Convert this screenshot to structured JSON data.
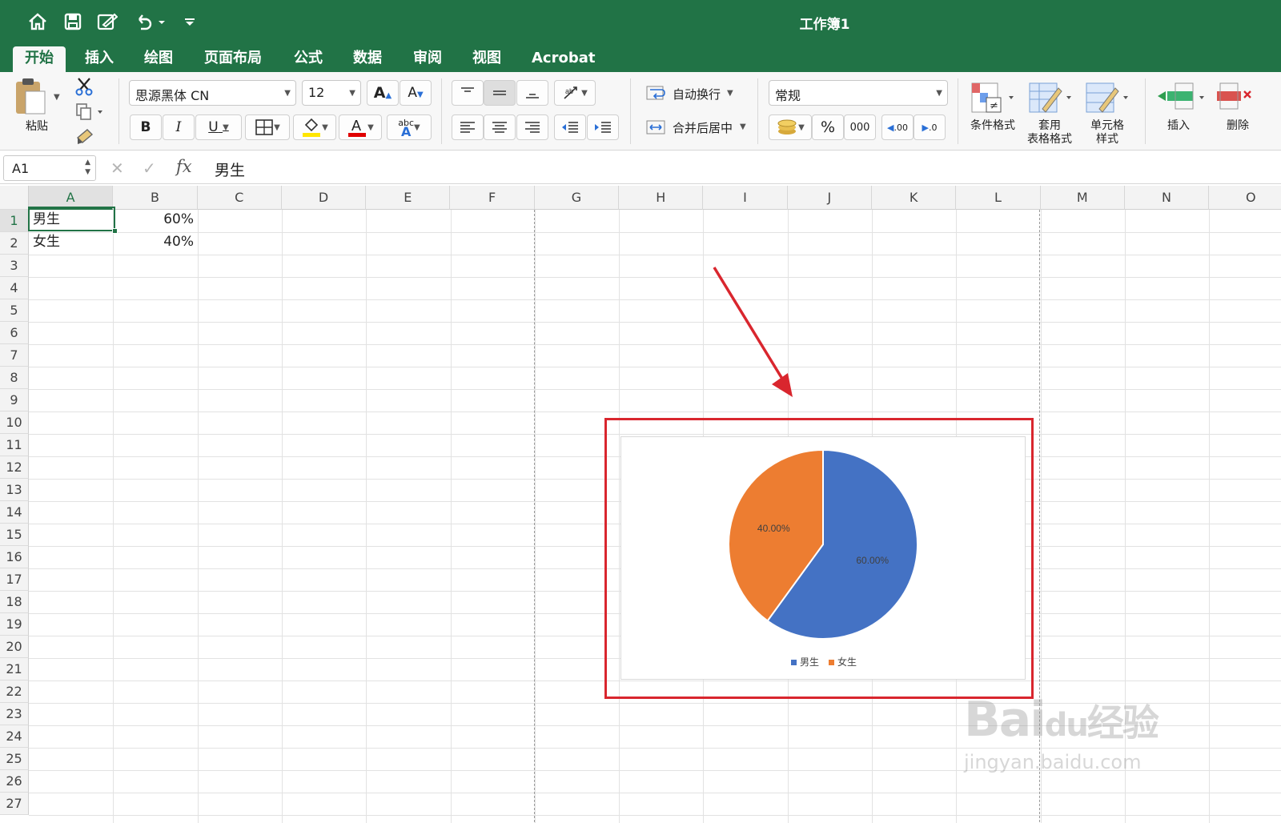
{
  "window": {
    "title": "工作簿1"
  },
  "quick_access": {
    "home_icon": "home-icon",
    "save_icon": "save-icon",
    "edit_icon": "edit-icon",
    "undo_icon": "undo-icon",
    "more_icon": "customize-icon"
  },
  "tabs": [
    {
      "label": "开始",
      "active": true
    },
    {
      "label": "插入"
    },
    {
      "label": "绘图"
    },
    {
      "label": "页面布局"
    },
    {
      "label": "公式"
    },
    {
      "label": "数据"
    },
    {
      "label": "审阅"
    },
    {
      "label": "视图"
    },
    {
      "label": "Acrobat"
    }
  ],
  "ribbon": {
    "paste_label": "粘贴",
    "font_name": "思源黑体 CN",
    "font_size": "12",
    "bold": "B",
    "italic": "I",
    "underline": "U",
    "wrap_text": "自动换行",
    "merge_center": "合并后居中",
    "number_format": "常规",
    "percent": "%",
    "thousands": "000",
    "cond_format": "条件格式",
    "table_format_1": "套用",
    "table_format_2": "表格格式",
    "cell_style_1": "单元格",
    "cell_style_2": "样式",
    "insert": "插入",
    "delete": "删除",
    "inc_decimal": ".00",
    "dec_decimal": ".0",
    "abc": "abc",
    "text_a": "A",
    "colors": {
      "highlight": "#ffe600",
      "font_color": "#e00000"
    }
  },
  "formula_bar": {
    "name_box": "A1",
    "fx": "fx",
    "content": "男生"
  },
  "columns": [
    "A",
    "B",
    "C",
    "D",
    "E",
    "F",
    "G",
    "H",
    "I",
    "J",
    "K",
    "L",
    "M",
    "N",
    "O"
  ],
  "rows": [
    "1",
    "2",
    "3",
    "4",
    "5",
    "6",
    "7",
    "8",
    "9",
    "10",
    "11",
    "12",
    "13",
    "14",
    "15",
    "16",
    "17",
    "18",
    "19",
    "20",
    "21",
    "22",
    "23",
    "24",
    "25",
    "26",
    "27"
  ],
  "cells": {
    "A1": "男生",
    "B1": "60%",
    "A2": "女生",
    "B2": "40%"
  },
  "chart_data": {
    "type": "pie",
    "categories": [
      "男生",
      "女生"
    ],
    "values": [
      60,
      40
    ],
    "data_labels": [
      "60.00%",
      "40.00%"
    ],
    "colors": [
      "#4472c4",
      "#ed7d31"
    ],
    "legend": "bottom"
  },
  "annotation": {
    "highlight_color": "#d9262e"
  },
  "watermark": {
    "line1": "Bai",
    "line2": "du",
    "line3": "经验",
    "url": "jingyan.baidu.com"
  }
}
